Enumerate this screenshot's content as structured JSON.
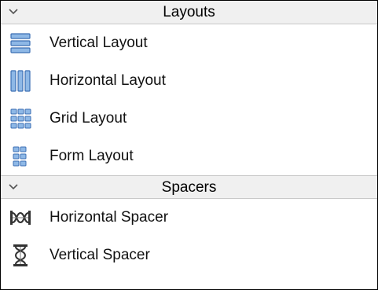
{
  "categories": [
    {
      "title": "Layouts",
      "chevron_icon": "chevron-down-icon",
      "items": [
        {
          "label": "Vertical Layout",
          "icon": "vertical-layout-icon"
        },
        {
          "label": "Horizontal Layout",
          "icon": "horizontal-layout-icon"
        },
        {
          "label": "Grid Layout",
          "icon": "grid-layout-icon"
        },
        {
          "label": "Form Layout",
          "icon": "form-layout-icon"
        }
      ]
    },
    {
      "title": "Spacers",
      "chevron_icon": "chevron-down-icon",
      "items": [
        {
          "label": "Horizontal Spacer",
          "icon": "horizontal-spacer-icon"
        },
        {
          "label": "Vertical Spacer",
          "icon": "vertical-spacer-icon"
        }
      ]
    }
  ],
  "colors": {
    "icon_fill": "#8eb8e6",
    "icon_stroke": "#3c6fb4",
    "spacer_dark": "#333333",
    "header_bg": "#f0f0f0"
  }
}
